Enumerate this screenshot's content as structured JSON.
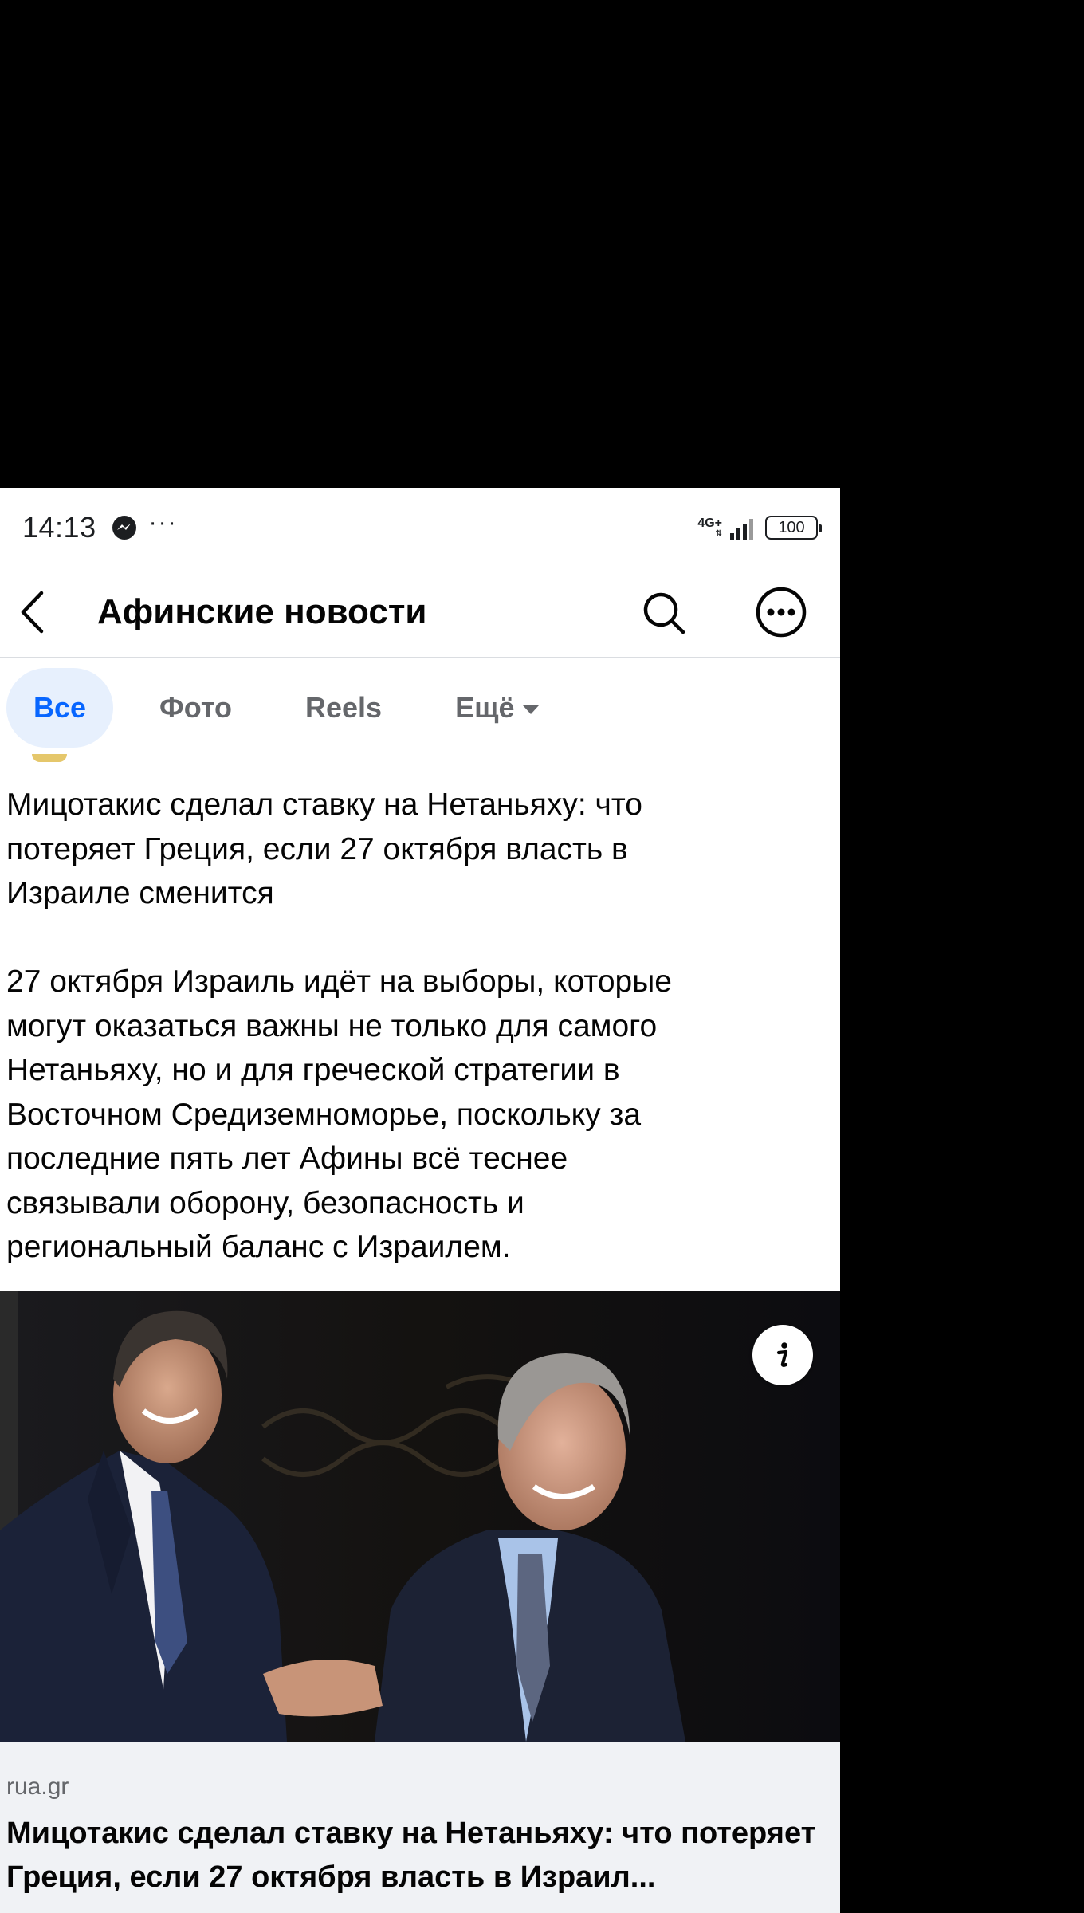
{
  "status_bar": {
    "time": "14:13",
    "more": "···",
    "network": "4G+",
    "battery": "100"
  },
  "header": {
    "title": "Афинские новости",
    "icons": [
      "back-arrow-icon",
      "search-icon",
      "more-options-icon"
    ]
  },
  "tabs": [
    {
      "label": "Все",
      "active": true
    },
    {
      "label": "Фото",
      "active": false
    },
    {
      "label": "Reels",
      "active": false
    },
    {
      "label": "Ещё",
      "active": false
    }
  ],
  "post": {
    "text": "Мицотакис сделал ставку на Нетаньяху: что\nпотеряет Греция, если 27 октября власть в\nИзраиле сменится\n\n27 октября Израиль идёт на выборы, которые\nмогут оказаться важны не только для самого\nНетаньяху, но и для греческой стратегии в\nВосточном Средиземноморье, поскольку за\nпоследние пять лет Афины всё теснее\nсвязывали оборону, безопасность и\nрегиональный баланс с Израилем.",
    "link": {
      "domain": "rua.gr",
      "title": "Мицотакис сделал ставку на Нетаньяху: что потеряет Греция, если 27 октября власть в Израил..."
    }
  },
  "colors": {
    "accent": "#0866ff",
    "active_tab_bg": "#e7f0fd",
    "link_preview_bg": "#f0f2f5"
  }
}
